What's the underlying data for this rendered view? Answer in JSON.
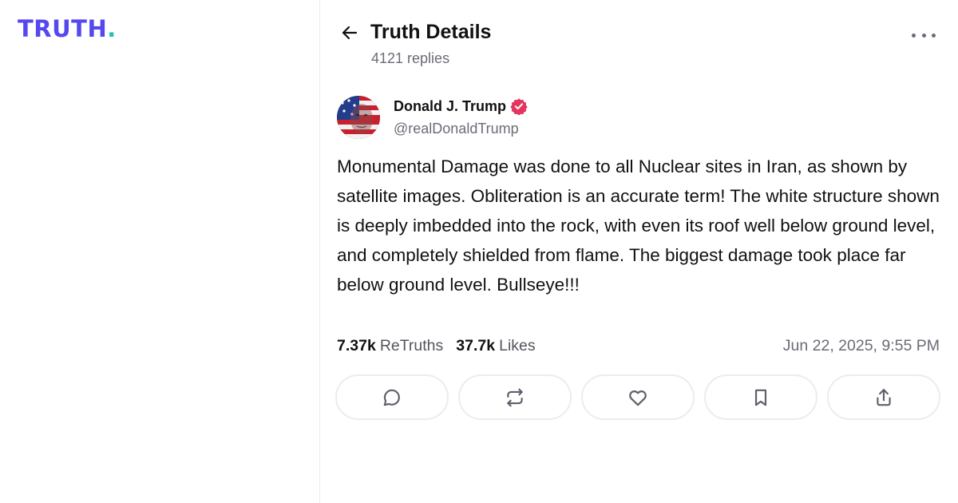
{
  "brand": {
    "logo_text": "TRUTH",
    "logo_dot": ".",
    "primary_color": "#5448ee",
    "accent_color": "#1fc2b0"
  },
  "header": {
    "back_icon": "arrow-left-icon",
    "title": "Truth Details",
    "replies": "4121 replies",
    "more_icon": "more-horizontal-icon"
  },
  "post": {
    "author_name": "Donald J. Trump",
    "handle": "@realDonaldTrump",
    "verified_icon": "verified-badge-icon",
    "verified_color": "#e3355d",
    "text": "Monumental Damage was done to all Nuclear sites in Iran, as shown by satellite images. Obliteration is an accurate term! The white structure shown is deeply imbedded into the rock, with even its roof well below ground level, and completely shielded from flame. The biggest damage took place far below ground level. Bullseye!!!",
    "retruths_count": "7.37k",
    "retruths_label": "ReTruths",
    "likes_count": "37.7k",
    "likes_label": "Likes",
    "timestamp": "Jun 22, 2025, 9:55 PM"
  },
  "actions": [
    {
      "name": "reply",
      "icon": "reply-bubble-icon"
    },
    {
      "name": "retruth",
      "icon": "retruth-icon"
    },
    {
      "name": "like",
      "icon": "heart-icon"
    },
    {
      "name": "bookmark",
      "icon": "bookmark-icon"
    },
    {
      "name": "share",
      "icon": "share-icon"
    }
  ]
}
